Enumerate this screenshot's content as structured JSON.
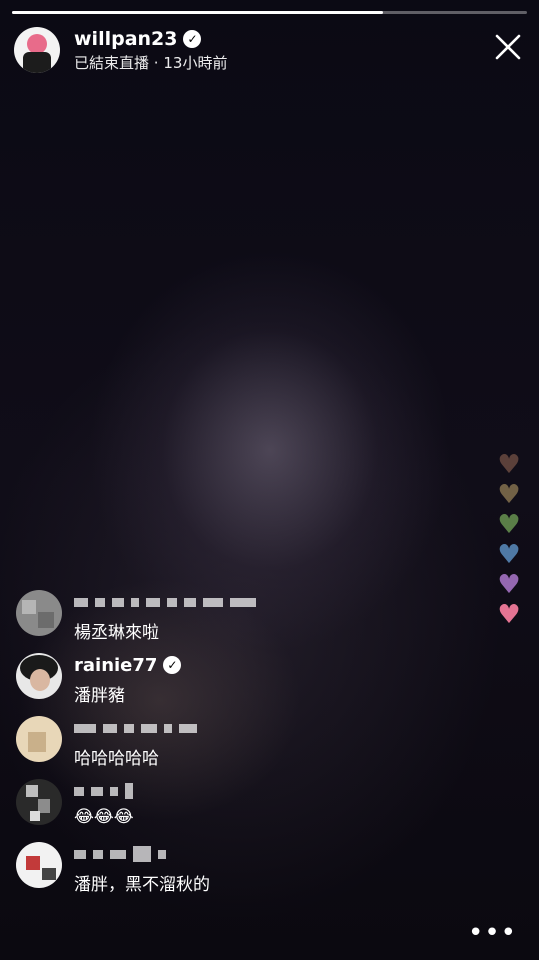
{
  "story": {
    "progress": 0.72
  },
  "header": {
    "username": "willpan23",
    "verified_icon": "verified-badge-icon",
    "status": "已結束直播",
    "separator": "·",
    "time_ago": "13小時前",
    "close_icon": "close-icon"
  },
  "comments": [
    {
      "name": "",
      "name_redacted": true,
      "text": "楊丞琳來啦",
      "verified": false
    },
    {
      "name": "rainie77",
      "name_redacted": false,
      "text": "潘胖豬",
      "verified": true
    },
    {
      "name": "",
      "name_redacted": true,
      "text": "哈哈哈哈哈",
      "verified": false
    },
    {
      "name": "",
      "name_redacted": true,
      "text": "😂😂😂",
      "verified": false
    },
    {
      "name": "",
      "name_redacted": true,
      "text": "潘胖，黑不溜秋的",
      "verified": false
    }
  ],
  "reactions": {
    "heart_colors": [
      "#e8a07a",
      "#e0c07a",
      "#8fce6a",
      "#6aa6e0",
      "#b07ad0",
      "#f07a9a"
    ]
  },
  "more_icon": "more-horizontal-icon"
}
